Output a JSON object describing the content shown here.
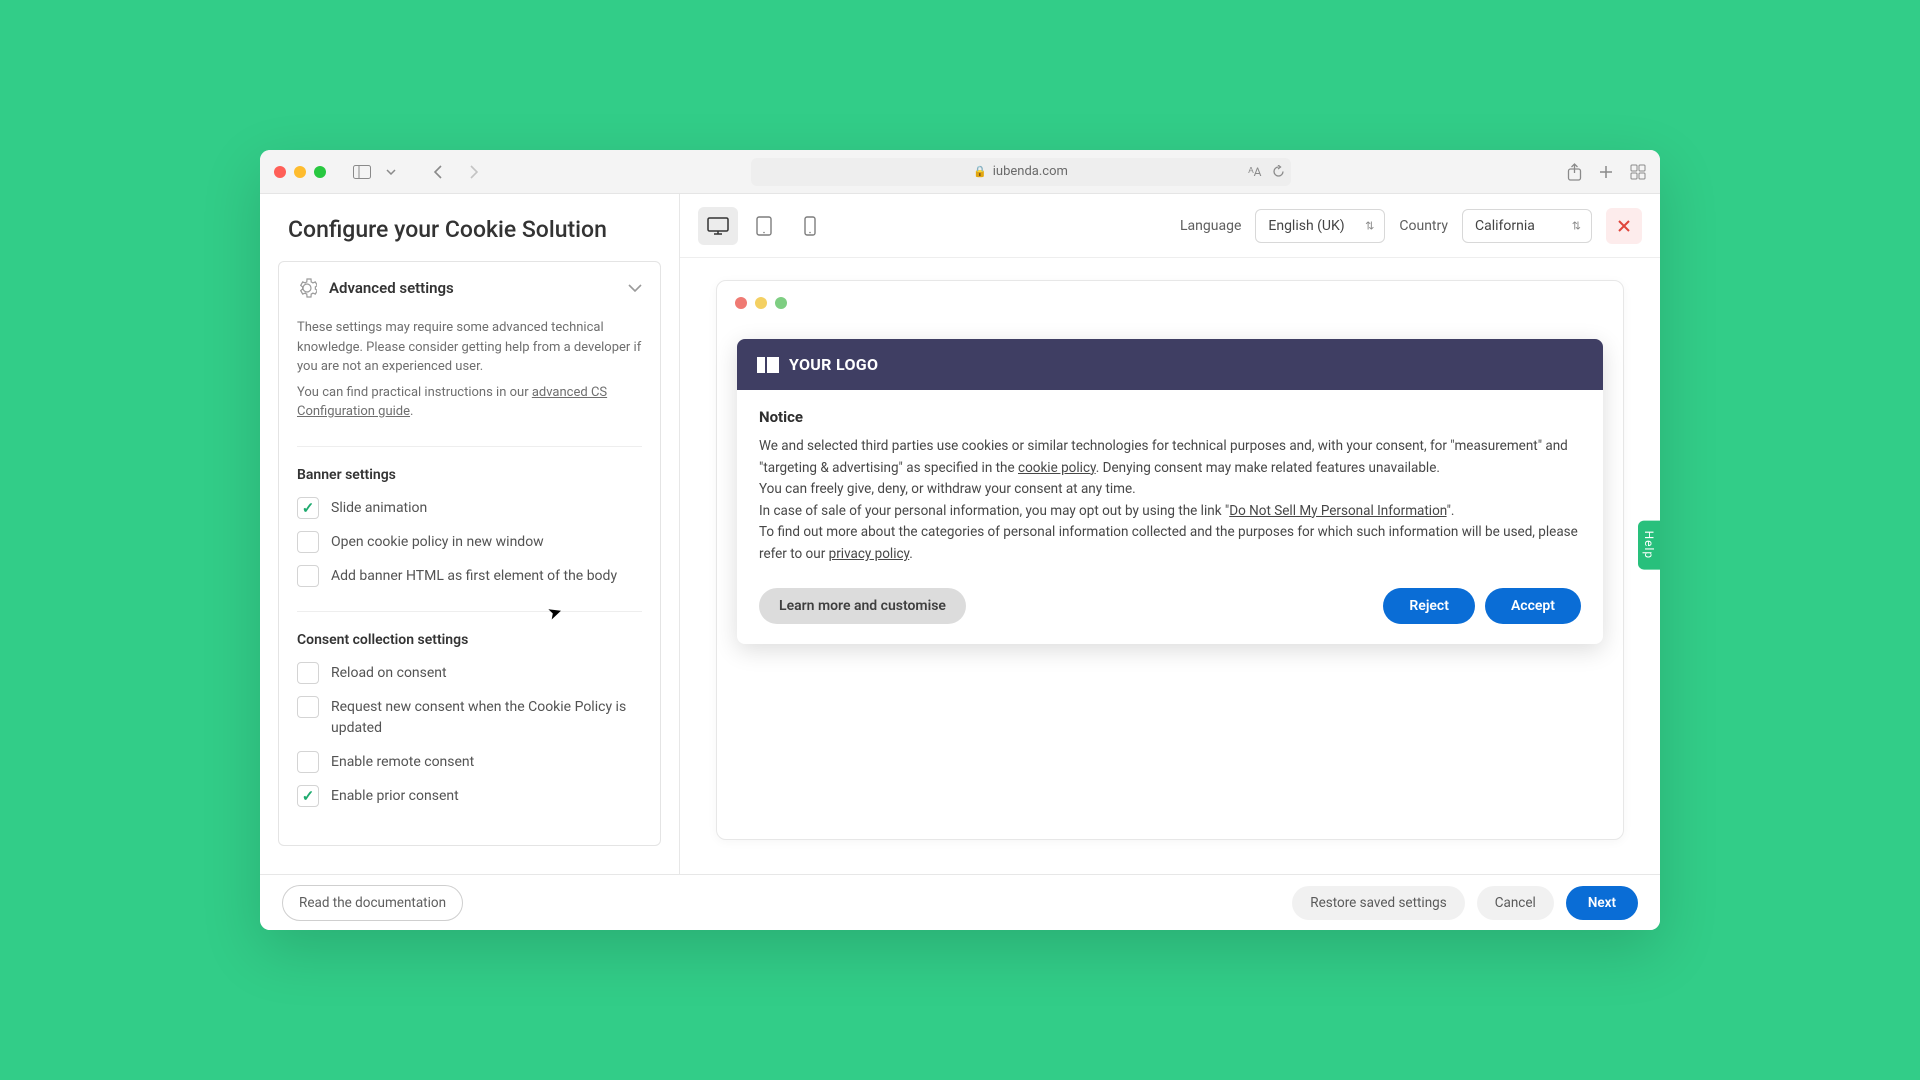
{
  "browser": {
    "url_host": "iubenda.com"
  },
  "app": {
    "title": "Configure your Cookie Solution",
    "advanced": {
      "header": "Advanced settings",
      "desc1": "These settings may require some advanced technical knowledge. Please consider getting help from a developer if you are not an experienced user.",
      "desc2_pre": "You can find practical instructions in our ",
      "desc2_link": "advanced CS Configuration guide",
      "desc2_post": "."
    },
    "banner_group": {
      "title": "Banner settings",
      "opt_slide": "Slide animation",
      "opt_newwin": "Open cookie policy in new window",
      "opt_addhtml": "Add banner HTML as first element of the body"
    },
    "consent_group": {
      "title": "Consent collection settings",
      "opt_reload": "Reload on consent",
      "opt_renew": "Request new consent when the Cookie Policy is updated",
      "opt_remote": "Enable remote consent",
      "opt_prior": "Enable prior consent"
    }
  },
  "preview_toolbar": {
    "language_label": "Language",
    "language_value": "English (UK)",
    "country_label": "Country",
    "country_value": "California"
  },
  "cookie_banner": {
    "logo_text": "YOUR LOGO",
    "title": "Notice",
    "p1_a": "We and selected third parties use cookies or similar technologies for technical purposes and, with your consent, for \"measurement\" and \"targeting & advertising\" as specified in the ",
    "p1_link1": "cookie policy",
    "p1_b": ". Denying consent may make related features unavailable.",
    "p2": "You can freely give, deny, or withdraw your consent at any time.",
    "p3_a": "In case of sale of your personal information, you may opt out by using the link \"",
    "p3_link": "Do Not Sell My Personal Information",
    "p3_b": "\".",
    "p4_a": "To find out more about the categories of personal information collected and the purposes for which such information will be used, please refer to our ",
    "p4_link": "privacy policy",
    "p4_b": ".",
    "btn_learn": "Learn more and customise",
    "btn_reject": "Reject",
    "btn_accept": "Accept"
  },
  "footer": {
    "read_docs": "Read the documentation",
    "restore": "Restore saved settings",
    "cancel": "Cancel",
    "next": "Next"
  },
  "help_tab": "Help"
}
